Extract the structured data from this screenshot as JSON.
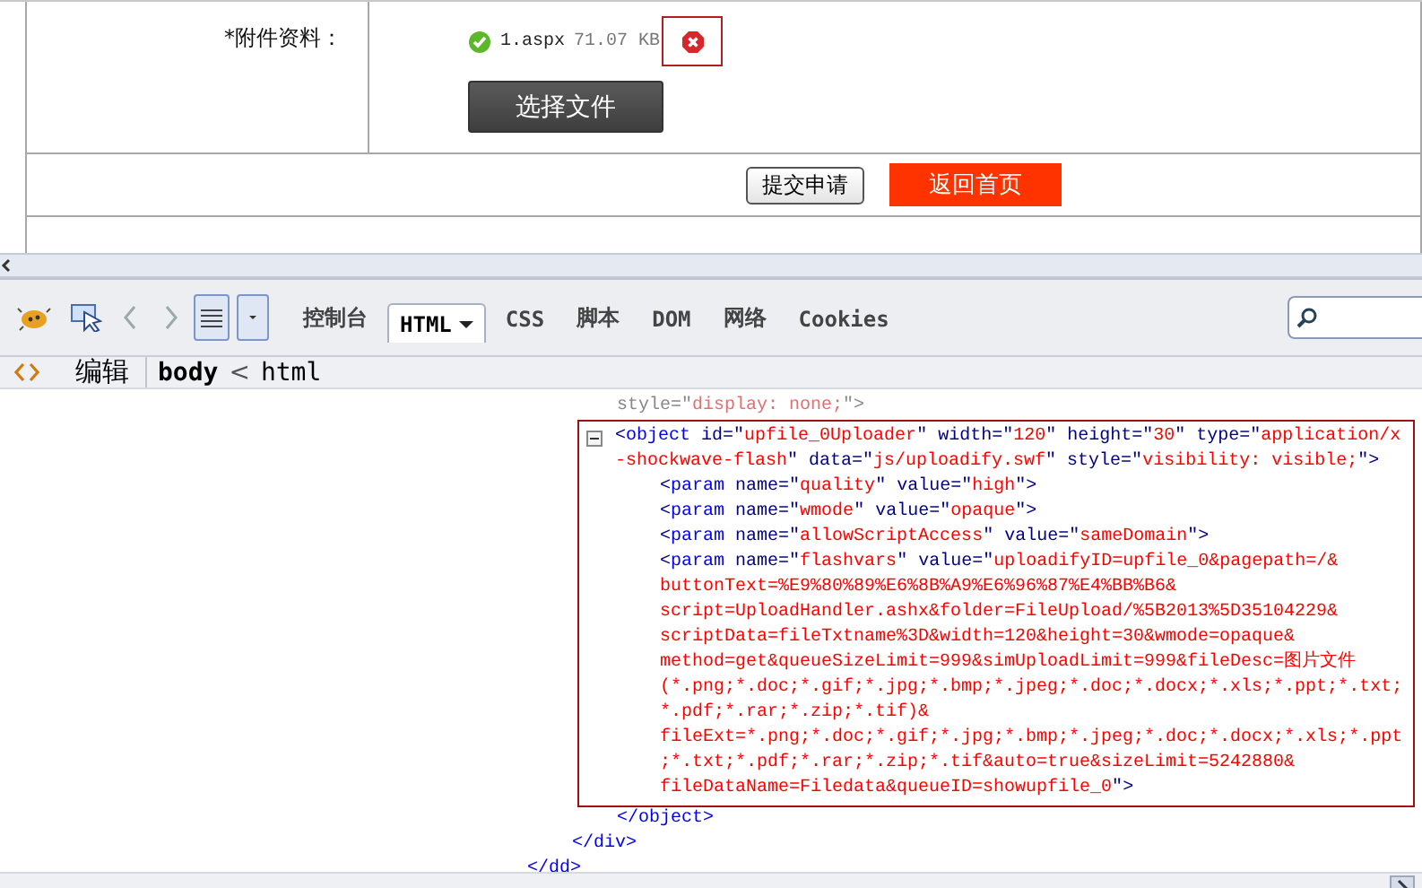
{
  "form": {
    "attachment_label": "*附件资料：",
    "file": {
      "name": "1.aspx",
      "size": "71.07 KB"
    },
    "choose_button": "选择文件",
    "submit_button": "提交申请",
    "home_button": "返回首页"
  },
  "devtools": {
    "tabs": [
      {
        "label": "控制台",
        "selected": false
      },
      {
        "label": "HTML",
        "selected": true,
        "dropdown": true
      },
      {
        "label": "CSS",
        "selected": false
      },
      {
        "label": "脚本",
        "selected": false
      },
      {
        "label": "DOM",
        "selected": false
      },
      {
        "label": "网络",
        "selected": false
      },
      {
        "label": "Cookies",
        "selected": false
      }
    ],
    "breadcrumb": {
      "edit_button": "编辑",
      "separator": "<",
      "items": [
        {
          "label": "body",
          "selected": true
        },
        {
          "label": "html",
          "selected": false
        }
      ]
    },
    "tree": {
      "close": "</dd>",
      "children": [
        {
          "close": "</div>",
          "children": [
            {
              "hidden": true,
              "open": [
                [
                  {
                    "kind": "attr",
                    "text": "style=\""
                  },
                  {
                    "kind": "value",
                    "text": "display: none;"
                  },
                  {
                    "kind": "attr",
                    "text": "\""
                  },
                  {
                    "kind": "bracket",
                    "text": ">"
                  }
                ]
              ]
            },
            {
              "selected": true,
              "expanded": true,
              "close": "</object>",
              "open": [
                [
                  {
                    "kind": "bracket",
                    "text": "<"
                  },
                  {
                    "kind": "tag",
                    "text": "object"
                  },
                  {
                    "kind": "attr",
                    "text": " id=\""
                  },
                  {
                    "kind": "value",
                    "text": "upfile_0Uploader"
                  },
                  {
                    "kind": "attr",
                    "text": "\" width=\""
                  },
                  {
                    "kind": "value",
                    "text": "120"
                  },
                  {
                    "kind": "attr",
                    "text": "\" height=\""
                  },
                  {
                    "kind": "value",
                    "text": "30"
                  },
                  {
                    "kind": "attr",
                    "text": "\" type=\""
                  },
                  {
                    "kind": "value",
                    "text": "application/x"
                  }
                ],
                [
                  {
                    "kind": "value",
                    "text": "-shockwave-flash"
                  },
                  {
                    "kind": "attr",
                    "text": "\" data=\""
                  },
                  {
                    "kind": "value",
                    "text": "js/uploadify.swf"
                  },
                  {
                    "kind": "attr",
                    "text": "\" style=\""
                  },
                  {
                    "kind": "value",
                    "text": "visibility: visible;"
                  },
                  {
                    "kind": "attr",
                    "text": "\""
                  },
                  {
                    "kind": "bracket",
                    "text": ">"
                  }
                ]
              ],
              "children": [
                {
                  "open": [
                    [
                      {
                        "kind": "bracket",
                        "text": "<"
                      },
                      {
                        "kind": "tag",
                        "text": "param"
                      },
                      {
                        "kind": "attr",
                        "text": " name=\""
                      },
                      {
                        "kind": "value",
                        "text": "quality"
                      },
                      {
                        "kind": "attr",
                        "text": "\" value=\""
                      },
                      {
                        "kind": "value",
                        "text": "high"
                      },
                      {
                        "kind": "attr",
                        "text": "\""
                      },
                      {
                        "kind": "bracket",
                        "text": ">"
                      }
                    ]
                  ]
                },
                {
                  "open": [
                    [
                      {
                        "kind": "bracket",
                        "text": "<"
                      },
                      {
                        "kind": "tag",
                        "text": "param"
                      },
                      {
                        "kind": "attr",
                        "text": " name=\""
                      },
                      {
                        "kind": "value",
                        "text": "wmode"
                      },
                      {
                        "kind": "attr",
                        "text": "\" value=\""
                      },
                      {
                        "kind": "value",
                        "text": "opaque"
                      },
                      {
                        "kind": "attr",
                        "text": "\""
                      },
                      {
                        "kind": "bracket",
                        "text": ">"
                      }
                    ]
                  ]
                },
                {
                  "open": [
                    [
                      {
                        "kind": "bracket",
                        "text": "<"
                      },
                      {
                        "kind": "tag",
                        "text": "param"
                      },
                      {
                        "kind": "attr",
                        "text": " name=\""
                      },
                      {
                        "kind": "value",
                        "text": "allowScriptAccess"
                      },
                      {
                        "kind": "attr",
                        "text": "\" value=\""
                      },
                      {
                        "kind": "value",
                        "text": "sameDomain"
                      },
                      {
                        "kind": "attr",
                        "text": "\""
                      },
                      {
                        "kind": "bracket",
                        "text": ">"
                      }
                    ]
                  ]
                },
                {
                  "open": [
                    [
                      {
                        "kind": "bracket",
                        "text": "<"
                      },
                      {
                        "kind": "tag",
                        "text": "param"
                      },
                      {
                        "kind": "attr",
                        "text": " name=\""
                      },
                      {
                        "kind": "value",
                        "text": "flashvars"
                      },
                      {
                        "kind": "attr",
                        "text": "\" value=\""
                      },
                      {
                        "kind": "value",
                        "text": "uploadifyID=upfile_0&pagepath=/&"
                      }
                    ],
                    [
                      {
                        "kind": "value",
                        "text": "buttonText=%E9%80%89%E6%8B%A9%E6%96%87%E4%BB%B6&"
                      }
                    ],
                    [
                      {
                        "kind": "value",
                        "text": "script=UploadHandler.ashx&folder=FileUpload/%5B2013%5D35104229&"
                      }
                    ],
                    [
                      {
                        "kind": "value",
                        "text": "scriptData=fileTxtname%3D&width=120&height=30&wmode=opaque&"
                      }
                    ],
                    [
                      {
                        "kind": "value",
                        "text": "method=get&queueSizeLimit=999&simUploadLimit=999&fileDesc=图片文件"
                      }
                    ],
                    [
                      {
                        "kind": "value",
                        "text": "(*.png;*.doc;*.gif;*.jpg;*.bmp;*.jpeg;*.doc;*.docx;*.xls;*.ppt;*.txt;"
                      }
                    ],
                    [
                      {
                        "kind": "value",
                        "text": "*.pdf;*.rar;*.zip;*.tif)&"
                      }
                    ],
                    [
                      {
                        "kind": "value",
                        "text": "fileExt=*.png;*.doc;*.gif;*.jpg;*.bmp;*.jpeg;*.doc;*.docx;*.xls;*.ppt"
                      }
                    ],
                    [
                      {
                        "kind": "value",
                        "text": ";*.txt;*.pdf;*.rar;*.zip;*.tif&auto=true&sizeLimit=5242880&"
                      }
                    ],
                    [
                      {
                        "kind": "value",
                        "text": "fileDataName=Filedata&queueID=showupfile_0"
                      },
                      {
                        "kind": "attr",
                        "text": "\""
                      },
                      {
                        "kind": "bracket",
                        "text": ">"
                      }
                    ]
                  ]
                }
              ]
            }
          ]
        }
      ]
    }
  }
}
